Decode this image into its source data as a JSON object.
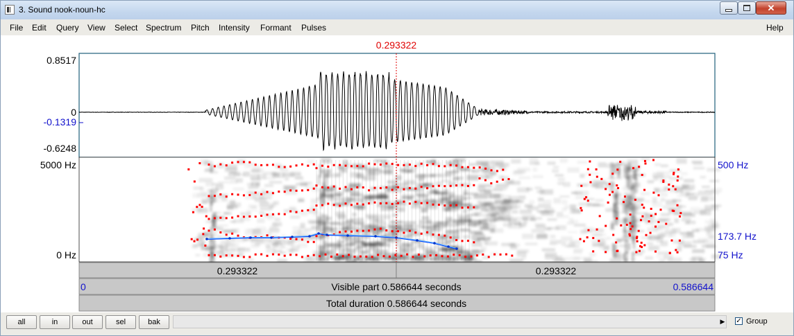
{
  "window": {
    "title": "3. Sound nook-noun-hc"
  },
  "menu": [
    "File",
    "Edit",
    "Query",
    "View",
    "Select",
    "Spectrum",
    "Pitch",
    "Intensity",
    "Formant",
    "Pulses"
  ],
  "menu_help": "Help",
  "cursor": {
    "time_label": "0.293322"
  },
  "waveform": {
    "ymax": "0.8517",
    "zero": "0",
    "ylevel": "-0.1319",
    "ymin": "-0.6248"
  },
  "spectrogram": {
    "top_label": "5000 Hz",
    "bottom_label": "0 Hz"
  },
  "pitch": {
    "top_label": "500 Hz",
    "value_label": "173.7 Hz",
    "bottom_label": "75 Hz"
  },
  "time_bar": {
    "left": "0.293322",
    "right": "0.293322"
  },
  "visible": {
    "start": "0",
    "label": "Visible part 0.586644 seconds",
    "end": "0.586644"
  },
  "total": {
    "label": "Total duration 0.586644 seconds"
  },
  "toolbar": {
    "all": "all",
    "in": "in",
    "out": "out",
    "sel": "sel",
    "bak": "bak",
    "group_label": "Group",
    "group_checked": "✓"
  },
  "colors": {
    "cursor": "#e00000",
    "pitch_labels": "#1111cc",
    "pitch_curve": "#0044ff",
    "formant": "#ff0000"
  }
}
